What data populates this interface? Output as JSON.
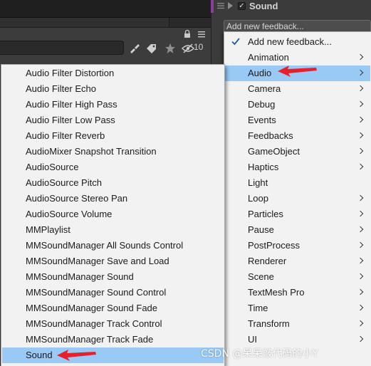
{
  "component_header": {
    "title": "Sound",
    "enabled_checkbox": "✓",
    "icons": [
      "hamburger-icon",
      "foldout-arrow-icon",
      "checkbox-icon"
    ],
    "accent_color": "#8a3fa0"
  },
  "feedback_dropdown": {
    "value": "Add new feedback..."
  },
  "toolbar": {
    "icons": [
      "lock-icon",
      "menu-icon",
      "brush-icon",
      "tag-icon",
      "star-icon",
      "eye-hidden-icon"
    ],
    "hidden_count": "10"
  },
  "main_menu": {
    "items": [
      {
        "label": "Add new feedback...",
        "checked": true,
        "submenu": false
      },
      {
        "label": "Animation",
        "submenu": true
      },
      {
        "label": "Audio",
        "submenu": true,
        "highlighted": true
      },
      {
        "label": "Camera",
        "submenu": true
      },
      {
        "label": "Debug",
        "submenu": true
      },
      {
        "label": "Events",
        "submenu": true
      },
      {
        "label": "Feedbacks",
        "submenu": true
      },
      {
        "label": "GameObject",
        "submenu": true
      },
      {
        "label": "Haptics",
        "submenu": true
      },
      {
        "label": "Light",
        "submenu": false
      },
      {
        "label": "Loop",
        "submenu": true
      },
      {
        "label": "Particles",
        "submenu": true
      },
      {
        "label": "Pause",
        "submenu": true
      },
      {
        "label": "PostProcess",
        "submenu": true
      },
      {
        "label": "Renderer",
        "submenu": true
      },
      {
        "label": "Scene",
        "submenu": true
      },
      {
        "label": "TextMesh Pro",
        "submenu": true
      },
      {
        "label": "Time",
        "submenu": true
      },
      {
        "label": "Transform",
        "submenu": true
      },
      {
        "label": "UI",
        "submenu": true
      }
    ]
  },
  "audio_submenu": {
    "items": [
      {
        "label": "Audio Filter Distortion"
      },
      {
        "label": "Audio Filter Echo"
      },
      {
        "label": "Audio Filter High Pass"
      },
      {
        "label": "Audio Filter Low Pass"
      },
      {
        "label": "Audio Filter Reverb"
      },
      {
        "label": "AudioMixer Snapshot Transition"
      },
      {
        "label": "AudioSource"
      },
      {
        "label": "AudioSource Pitch"
      },
      {
        "label": "AudioSource Stereo Pan"
      },
      {
        "label": "AudioSource Volume"
      },
      {
        "label": "MMPlaylist"
      },
      {
        "label": "MMSoundManager All Sounds Control"
      },
      {
        "label": "MMSoundManager Save and Load"
      },
      {
        "label": "MMSoundManager Sound"
      },
      {
        "label": "MMSoundManager Sound Control"
      },
      {
        "label": "MMSoundManager Sound Fade"
      },
      {
        "label": "MMSoundManager Track Control"
      },
      {
        "label": "MMSoundManager Track Fade"
      },
      {
        "label": "Sound",
        "highlighted": true
      }
    ]
  },
  "annotations": {
    "arrow_color": "#e8202a"
  },
  "watermark": "CSDN @呆呆敲代码的小Y",
  "colors": {
    "menu_bg": "#f2f2f2",
    "highlight": "#99c9f5",
    "editor_bg": "#383838"
  }
}
